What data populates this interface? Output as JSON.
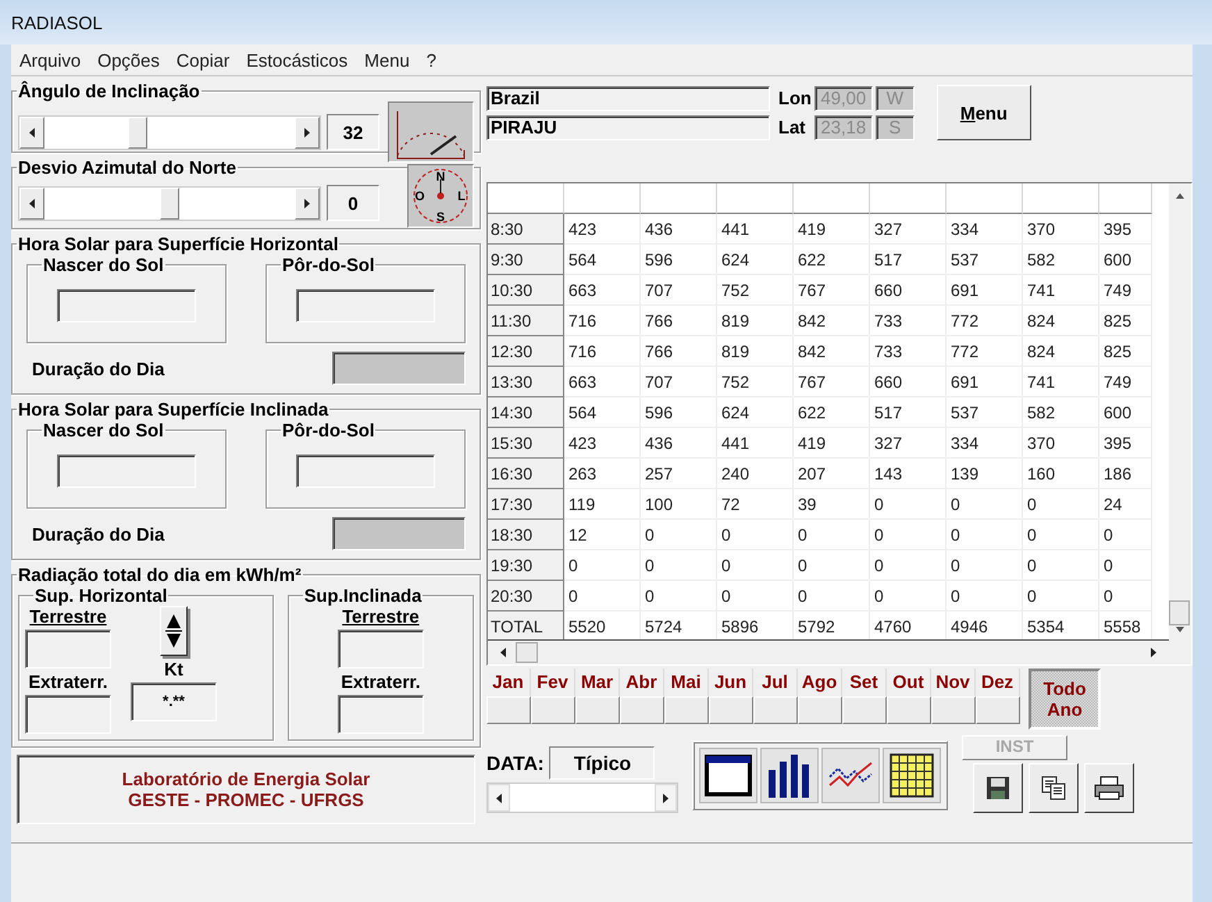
{
  "window": {
    "title": "RADIASOL"
  },
  "menu": [
    {
      "label": "Arquivo"
    },
    {
      "label": "Opções"
    },
    {
      "label": "Copiar"
    },
    {
      "label": "Estocásticos"
    },
    {
      "label": "Menu"
    },
    {
      "label": "?"
    }
  ],
  "tilt": {
    "title": "Ângulo de Inclinação",
    "level": 0.36,
    "value": "32"
  },
  "azimuth": {
    "title": "Desvio Azimutal do Norte",
    "level": 0.5,
    "value": "0",
    "compass": [
      "N",
      "L",
      "S",
      "O"
    ]
  },
  "horizontal_sun": {
    "title": "Hora Solar para Superfície Horizontal",
    "sunrise_label": "Nascer do Sol",
    "sunset_label": "Pôr-do-Sol",
    "day_length_label": "Duração do Dia"
  },
  "inclined_sun": {
    "title": "Hora Solar para Superfície Inclinada",
    "sunrise_label": "Nascer do Sol",
    "sunset_label": "Pôr-do-Sol",
    "day_length_label": "Duração do Dia"
  },
  "radiation": {
    "title": "Radiação total do dia em kWh/m²",
    "horizontal": {
      "title": "Sup. Horizontal",
      "terrestrial_label": "Terrestre",
      "extra_label": "Extraterr."
    },
    "kt_label": "Kt",
    "kt_value": "*.**",
    "inclined": {
      "title": "Sup.Inclinada",
      "terrestrial_label": "Terrestre",
      "extra_label": "Extraterr."
    }
  },
  "credits": [
    "Laboratório de Energia Solar",
    "GESTE - PROMEC - UFRGS"
  ],
  "location": {
    "country": "Brazil",
    "city": "PIRAJU",
    "lon_label": "Lon",
    "lon": "49,00",
    "lon_dir": "W",
    "lat_label": "Lat",
    "lat": "23,18",
    "lat_dir": "S"
  },
  "menu_button": {
    "label": "Menu"
  },
  "table": {
    "rows": [
      {
        "label": "8:30",
        "values": [
          "423",
          "436",
          "441",
          "419",
          "327",
          "334",
          "370",
          "395"
        ]
      },
      {
        "label": "9:30",
        "values": [
          "564",
          "596",
          "624",
          "622",
          "517",
          "537",
          "582",
          "600"
        ]
      },
      {
        "label": "10:30",
        "values": [
          "663",
          "707",
          "752",
          "767",
          "660",
          "691",
          "741",
          "749"
        ]
      },
      {
        "label": "11:30",
        "values": [
          "716",
          "766",
          "819",
          "842",
          "733",
          "772",
          "824",
          "825"
        ]
      },
      {
        "label": "12:30",
        "values": [
          "716",
          "766",
          "819",
          "842",
          "733",
          "772",
          "824",
          "825"
        ]
      },
      {
        "label": "13:30",
        "values": [
          "663",
          "707",
          "752",
          "767",
          "660",
          "691",
          "741",
          "749"
        ]
      },
      {
        "label": "14:30",
        "values": [
          "564",
          "596",
          "624",
          "622",
          "517",
          "537",
          "582",
          "600"
        ]
      },
      {
        "label": "15:30",
        "values": [
          "423",
          "436",
          "441",
          "419",
          "327",
          "334",
          "370",
          "395"
        ]
      },
      {
        "label": "16:30",
        "values": [
          "263",
          "257",
          "240",
          "207",
          "143",
          "139",
          "160",
          "186"
        ]
      },
      {
        "label": "17:30",
        "values": [
          "119",
          "100",
          "72",
          "39",
          "0",
          "0",
          "0",
          "24"
        ]
      },
      {
        "label": "18:30",
        "values": [
          "12",
          "0",
          "0",
          "0",
          "0",
          "0",
          "0",
          "0"
        ]
      },
      {
        "label": "19:30",
        "values": [
          "0",
          "0",
          "0",
          "0",
          "0",
          "0",
          "0",
          "0"
        ]
      },
      {
        "label": "20:30",
        "values": [
          "0",
          "0",
          "0",
          "0",
          "0",
          "0",
          "0",
          "0"
        ]
      },
      {
        "label": "TOTAL",
        "values": [
          "5520",
          "5724",
          "5896",
          "5792",
          "4760",
          "4946",
          "5354",
          "5558"
        ]
      }
    ]
  },
  "months": [
    {
      "label": "Jan",
      "selected": false
    },
    {
      "label": "Fev",
      "selected": false
    },
    {
      "label": "Mar",
      "selected": false
    },
    {
      "label": "Abr",
      "selected": false
    },
    {
      "label": "Mai",
      "selected": false
    },
    {
      "label": "Jun",
      "selected": false
    },
    {
      "label": "Jul",
      "selected": false
    },
    {
      "label": "Ago",
      "selected": false
    },
    {
      "label": "Set",
      "selected": false
    },
    {
      "label": "Out",
      "selected": false
    },
    {
      "label": "Nov",
      "selected": false
    },
    {
      "label": "Dez",
      "selected": false
    }
  ],
  "all_year": {
    "label": "Todo Ano",
    "selected": true
  },
  "inst": {
    "label": "INST",
    "disabled": true
  },
  "data": {
    "label": "DATA:",
    "value": "Típico"
  },
  "view_buttons": [
    {
      "kind": "window"
    },
    {
      "kind": "bars"
    },
    {
      "kind": "lines"
    },
    {
      "kind": "grid"
    }
  ],
  "file_buttons": [
    {
      "kind": "save"
    },
    {
      "kind": "copy"
    },
    {
      "kind": "print"
    }
  ]
}
